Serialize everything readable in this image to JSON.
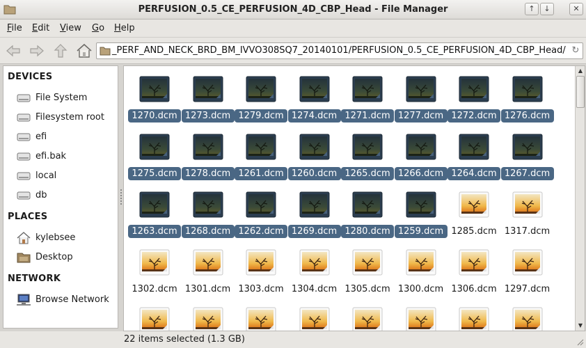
{
  "window": {
    "title": "PERFUSION_0.5_CE_PERFUSION_4D_CBP_Head - File Manager",
    "buttons": [
      "↑",
      "↓",
      "✕"
    ]
  },
  "menu": [
    {
      "accel": "F",
      "rest": "ile"
    },
    {
      "accel": "E",
      "rest": "dit"
    },
    {
      "accel": "V",
      "rest": "iew"
    },
    {
      "accel": "G",
      "rest": "o"
    },
    {
      "accel": "H",
      "rest": "elp"
    }
  ],
  "location": {
    "path": "_PERF_AND_NECK_BRD_BM_IVVO308SQ7_20140101/PERFUSION_0.5_CE_PERFUSION_4D_CBP_Head/"
  },
  "sidebar": {
    "devices_header": "DEVICES",
    "devices": [
      {
        "label": "File System",
        "icon": "drive-icon"
      },
      {
        "label": "Filesystem root",
        "icon": "drive-icon"
      },
      {
        "label": "efi",
        "icon": "drive-icon"
      },
      {
        "label": "efi.bak",
        "icon": "drive-icon"
      },
      {
        "label": "local",
        "icon": "drive-icon"
      },
      {
        "label": "db",
        "icon": "drive-icon"
      }
    ],
    "places_header": "PLACES",
    "places": [
      {
        "label": "kylebsee",
        "icon": "home-icon"
      },
      {
        "label": "Desktop",
        "icon": "desktop-icon"
      }
    ],
    "network_header": "NETWORK",
    "network": [
      {
        "label": "Browse Network",
        "icon": "network-icon"
      }
    ]
  },
  "files": [
    {
      "name": "1270.dcm",
      "selected": true
    },
    {
      "name": "1273.dcm",
      "selected": true
    },
    {
      "name": "1279.dcm",
      "selected": true
    },
    {
      "name": "1274.dcm",
      "selected": true
    },
    {
      "name": "1271.dcm",
      "selected": true
    },
    {
      "name": "1277.dcm",
      "selected": true
    },
    {
      "name": "1272.dcm",
      "selected": true
    },
    {
      "name": "1276.dcm",
      "selected": true
    },
    {
      "name": "1275.dcm",
      "selected": true
    },
    {
      "name": "1278.dcm",
      "selected": true
    },
    {
      "name": "1261.dcm",
      "selected": true
    },
    {
      "name": "1260.dcm",
      "selected": true
    },
    {
      "name": "1265.dcm",
      "selected": true
    },
    {
      "name": "1266.dcm",
      "selected": true
    },
    {
      "name": "1264.dcm",
      "selected": true
    },
    {
      "name": "1267.dcm",
      "selected": true
    },
    {
      "name": "1263.dcm",
      "selected": true
    },
    {
      "name": "1268.dcm",
      "selected": true
    },
    {
      "name": "1262.dcm",
      "selected": true
    },
    {
      "name": "1269.dcm",
      "selected": true
    },
    {
      "name": "1280.dcm",
      "selected": true
    },
    {
      "name": "1259.dcm",
      "selected": true
    },
    {
      "name": "1285.dcm",
      "selected": false
    },
    {
      "name": "1317.dcm",
      "selected": false
    },
    {
      "name": "1302.dcm",
      "selected": false
    },
    {
      "name": "1301.dcm",
      "selected": false
    },
    {
      "name": "1303.dcm",
      "selected": false
    },
    {
      "name": "1304.dcm",
      "selected": false
    },
    {
      "name": "1305.dcm",
      "selected": false
    },
    {
      "name": "1300.dcm",
      "selected": false
    },
    {
      "name": "1306.dcm",
      "selected": false
    },
    {
      "name": "1297.dcm",
      "selected": false
    },
    {
      "name": "",
      "selected": false
    },
    {
      "name": "",
      "selected": false
    },
    {
      "name": "",
      "selected": false
    },
    {
      "name": "",
      "selected": false
    },
    {
      "name": "",
      "selected": false
    },
    {
      "name": "",
      "selected": false
    },
    {
      "name": "",
      "selected": false
    },
    {
      "name": "",
      "selected": false
    }
  ],
  "status": {
    "text": "22 items selected (1.3 GB)"
  },
  "colors": {
    "selection": "#4a6784",
    "sidebar_bg": "#ffffff",
    "chrome_bg": "#e8e6e2"
  }
}
